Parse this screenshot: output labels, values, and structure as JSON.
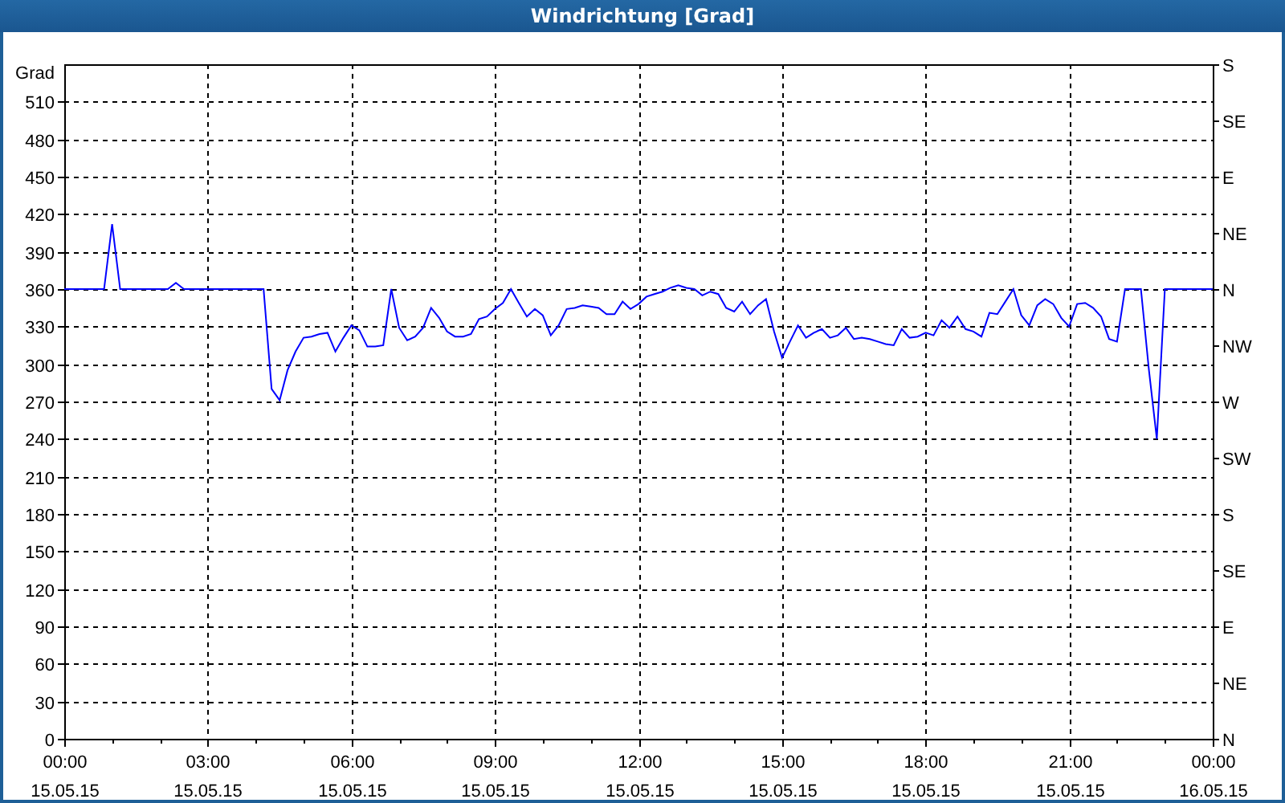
{
  "window": {
    "title": "Windrichtung [Grad]"
  },
  "chart": {
    "compass_ticks": [
      "S",
      "SE",
      "E",
      "NE",
      "N",
      "NW",
      "W",
      "SW",
      "S",
      "SE",
      "E",
      "NE",
      "N"
    ],
    "chart_data": {
      "type": "line",
      "ylabel": "Grad",
      "grid": true,
      "ylim": [
        0,
        540
      ],
      "yticks": [
        0,
        30,
        60,
        90,
        120,
        150,
        180,
        210,
        240,
        270,
        300,
        330,
        360,
        390,
        420,
        450,
        480,
        510
      ],
      "categories": [
        "00:00\n15.05.15",
        null,
        null,
        null,
        null,
        null,
        null,
        null,
        null,
        null,
        null,
        null,
        null,
        null,
        null,
        null,
        null,
        null,
        "03:00\n15.05.15",
        null,
        null,
        null,
        null,
        null,
        null,
        null,
        null,
        null,
        null,
        null,
        null,
        null,
        null,
        null,
        null,
        null,
        "06:00\n15.05.15",
        null,
        null,
        null,
        null,
        null,
        null,
        null,
        null,
        null,
        null,
        null,
        null,
        null,
        null,
        null,
        null,
        null,
        "09:00\n15.05.15",
        null,
        null,
        null,
        null,
        null,
        null,
        null,
        null,
        null,
        null,
        null,
        null,
        null,
        null,
        null,
        null,
        null,
        "12:00\n15.05.15",
        null,
        null,
        null,
        null,
        null,
        null,
        null,
        null,
        null,
        null,
        null,
        null,
        null,
        null,
        null,
        null,
        null,
        "15:00\n15.05.15",
        null,
        null,
        null,
        null,
        null,
        null,
        null,
        null,
        null,
        null,
        null,
        null,
        null,
        null,
        null,
        null,
        null,
        "18:00\n15.05.15",
        null,
        null,
        null,
        null,
        null,
        null,
        null,
        null,
        null,
        null,
        null,
        null,
        null,
        null,
        null,
        null,
        null,
        "21:00\n15.05.15",
        null,
        null,
        null,
        null,
        null,
        null,
        null,
        null,
        null,
        null,
        null,
        null,
        null,
        null,
        null,
        null,
        null,
        "00:00\n16.05.15"
      ],
      "series": [
        {
          "color": "#0000ff",
          "values": [
            360,
            360,
            360,
            360,
            360,
            360,
            412,
            360,
            360,
            360,
            360,
            360,
            360,
            360,
            365,
            360,
            360,
            360,
            360,
            360,
            360,
            360,
            360,
            360,
            360,
            360,
            280,
            271,
            295,
            310,
            321,
            322,
            324,
            325,
            310,
            321,
            331,
            327,
            314,
            314,
            315,
            360,
            329,
            319,
            322,
            329,
            345,
            337,
            326,
            322,
            322,
            324,
            336,
            338,
            344,
            349,
            360,
            349,
            338,
            344,
            339,
            323,
            331,
            344,
            345,
            347,
            346,
            345,
            340,
            340,
            350,
            344,
            348,
            354,
            356,
            358,
            361,
            363,
            361,
            360,
            355,
            358,
            356,
            345,
            342,
            350,
            340,
            347,
            352,
            326,
            305,
            318,
            331,
            321,
            325,
            328,
            321,
            323,
            329,
            320,
            321,
            320,
            318,
            316,
            315,
            328,
            321,
            322,
            325,
            323,
            335,
            329,
            338,
            328,
            326,
            322,
            341,
            340,
            350,
            360,
            339,
            331,
            347,
            352,
            348,
            337,
            330,
            348,
            349,
            345,
            338,
            320,
            318,
            360,
            360,
            360,
            295,
            240,
            360,
            360,
            360,
            360,
            360,
            360,
            360
          ]
        }
      ]
    }
  }
}
